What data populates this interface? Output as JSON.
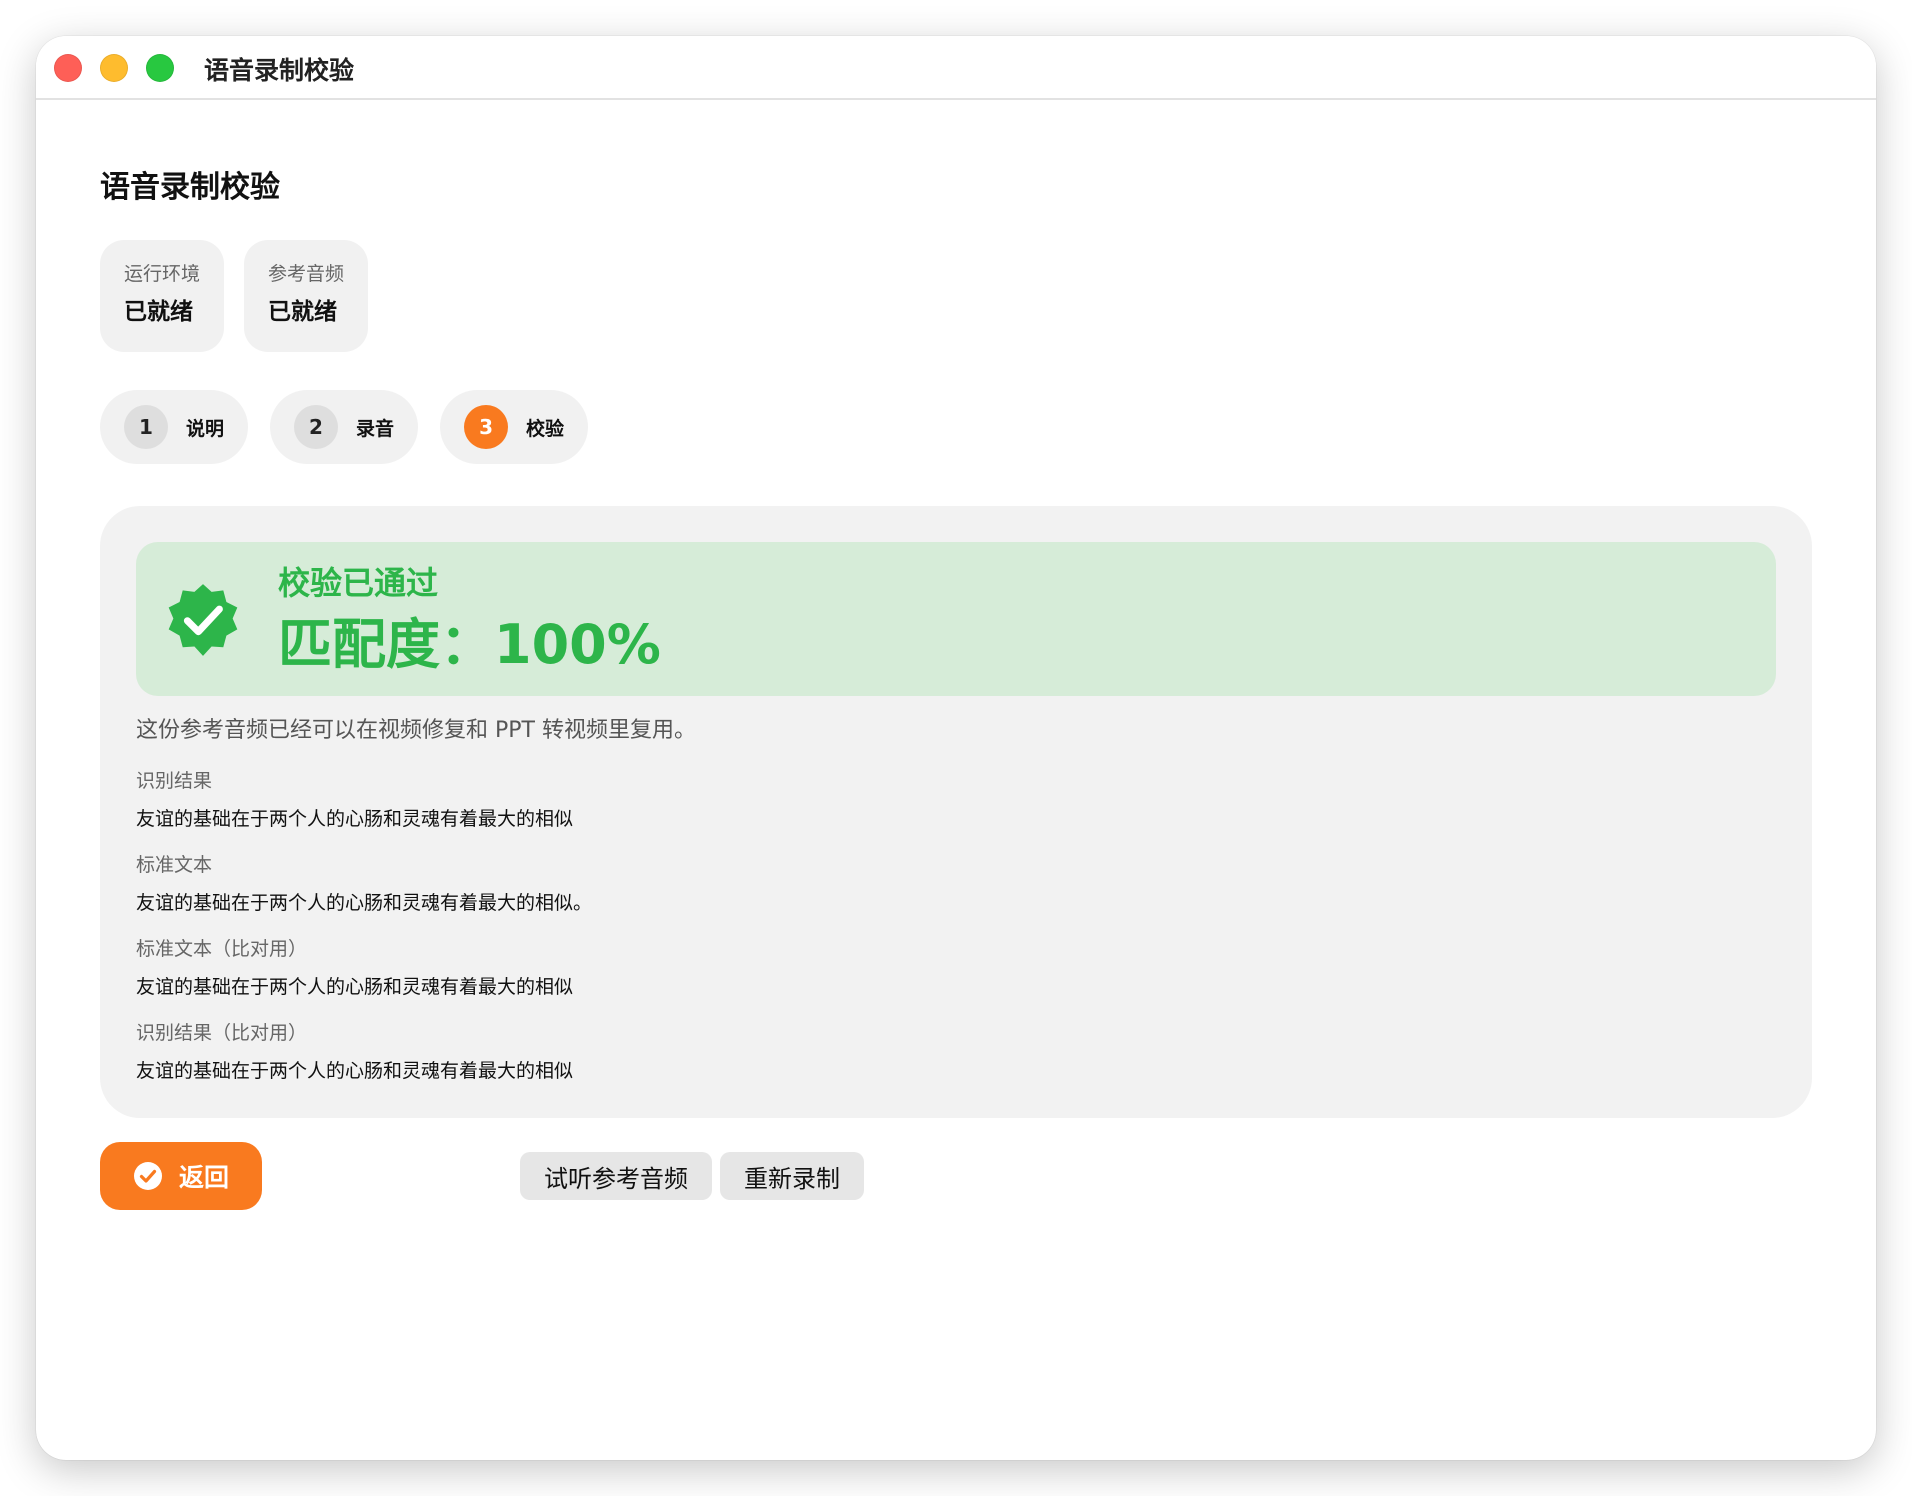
{
  "window": {
    "title": "语音录制校验"
  },
  "page": {
    "title": "语音录制校验"
  },
  "status_cards": [
    {
      "label": "运行环境",
      "value": "已就绪"
    },
    {
      "label": "参考音频",
      "value": "已就绪"
    }
  ],
  "steps": [
    {
      "number": "1",
      "label": "说明",
      "active": false
    },
    {
      "number": "2",
      "label": "录音",
      "active": false
    },
    {
      "number": "3",
      "label": "校验",
      "active": true
    }
  ],
  "result": {
    "status_title": "校验已通过",
    "score_text": "匹配度：100%",
    "match_percent": 100,
    "note": "这份参考音频已经可以在视频修复和 PPT 转视频里复用。",
    "fields": [
      {
        "label": "识别结果",
        "value": "友谊的基础在于两个人的心肠和灵魂有着最大的相似"
      },
      {
        "label": "标准文本",
        "value": "友谊的基础在于两个人的心肠和灵魂有着最大的相似。"
      },
      {
        "label": "标准文本（比对用）",
        "value": "友谊的基础在于两个人的心肠和灵魂有着最大的相似"
      },
      {
        "label": "识别结果（比对用）",
        "value": "友谊的基础在于两个人的心肠和灵魂有着最大的相似"
      }
    ]
  },
  "actions": {
    "back_label": "返回",
    "preview_label": "试听参考音频",
    "rerecord_label": "重新录制"
  },
  "icons": {
    "success_badge": "verified-badge-icon",
    "back_button": "check-circle-icon"
  },
  "colors": {
    "accent": "#f97a1f",
    "success": "#2db54a",
    "success_bg": "#d6ecd8",
    "panel_bg": "#f2f2f2"
  }
}
